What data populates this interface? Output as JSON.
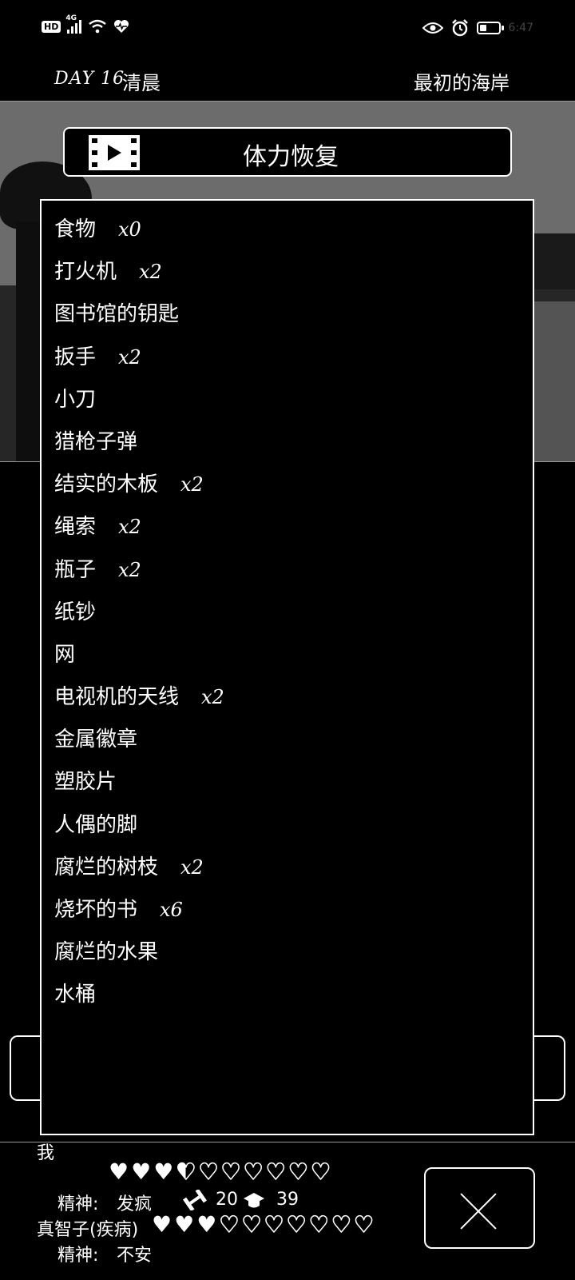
{
  "status_bar": {
    "hd": "HD",
    "network": "4G",
    "time": "6:47",
    "battery_level_percent": 40
  },
  "header": {
    "day": "DAY 16",
    "time_of_day": "清晨",
    "location": "最初的海岸"
  },
  "video_button": {
    "label": "体力恢复",
    "icon": "film-play-icon"
  },
  "inventory": {
    "items": [
      {
        "name": "食物",
        "qty": "x0"
      },
      {
        "name": "打火机",
        "qty": "x2"
      },
      {
        "name": "图书馆的钥匙",
        "qty": ""
      },
      {
        "name": "扳手",
        "qty": "x2"
      },
      {
        "name": "小刀",
        "qty": ""
      },
      {
        "name": "猎枪子弹",
        "qty": ""
      },
      {
        "name": "结实的木板",
        "qty": "x2"
      },
      {
        "name": "绳索",
        "qty": "x2"
      },
      {
        "name": "瓶子",
        "qty": "x2"
      },
      {
        "name": "纸钞",
        "qty": ""
      },
      {
        "name": "网",
        "qty": ""
      },
      {
        "name": "电视机的天线",
        "qty": "x2"
      },
      {
        "name": "金属徽章",
        "qty": ""
      },
      {
        "name": "塑胶片",
        "qty": ""
      },
      {
        "name": "人偶的脚",
        "qty": ""
      },
      {
        "name": "腐烂的树枝",
        "qty": "x2"
      },
      {
        "name": "烧坏的书",
        "qty": "x6"
      },
      {
        "name": "腐烂的水果",
        "qty": ""
      },
      {
        "name": "水桶",
        "qty": ""
      }
    ]
  },
  "characters": {
    "me": {
      "name": "我",
      "hearts_total": 10,
      "hearts_filled": 3.5,
      "mind_label": "精神:",
      "mind_value": "发疯",
      "strength": "20",
      "intelligence": "39"
    },
    "companion": {
      "name": "真智子(疾病)",
      "hearts_total": 10,
      "hearts_filled": 3,
      "mind_label": "精神:",
      "mind_value": "不安"
    }
  },
  "close_button": {
    "icon": "close-icon"
  }
}
